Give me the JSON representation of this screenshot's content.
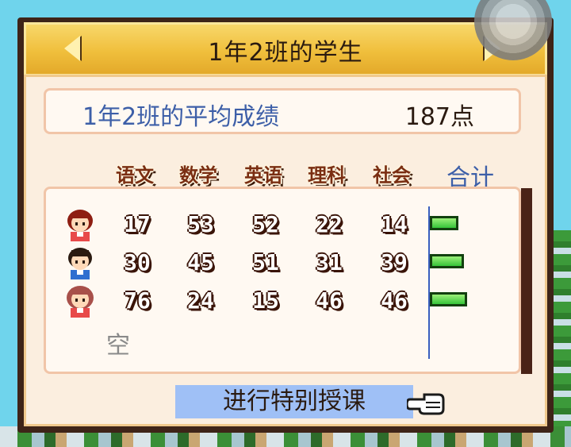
{
  "window": {
    "title": "1年2班的学生"
  },
  "average": {
    "label": "1年2班的平均成绩",
    "value": "187点"
  },
  "subjects": [
    "语文",
    "数学",
    "英语",
    "理科",
    "社会"
  ],
  "total_label": "合计",
  "students": [
    {
      "avatar": "girl-red-hair-icon",
      "scores": [
        "17",
        "53",
        "52",
        "22",
        "14"
      ],
      "total_bar_fraction": 0.6
    },
    {
      "avatar": "boy-blue-shirt-icon",
      "scores": [
        "30",
        "45",
        "51",
        "31",
        "39"
      ],
      "total_bar_fraction": 0.72
    },
    {
      "avatar": "girl-pink-hair-icon",
      "scores": [
        "76",
        "24",
        "15",
        "46",
        "46"
      ],
      "total_bar_fraction": 0.78
    }
  ],
  "empty_slot_label": "空",
  "special_lesson_button": "进行特别授课",
  "colors": {
    "title_bar": "#f0bf3c",
    "panel": "#fbeedf",
    "accent_blue": "#3d5fa8",
    "bar_green": "#36c43a",
    "button_blue": "#9fc0f6"
  }
}
